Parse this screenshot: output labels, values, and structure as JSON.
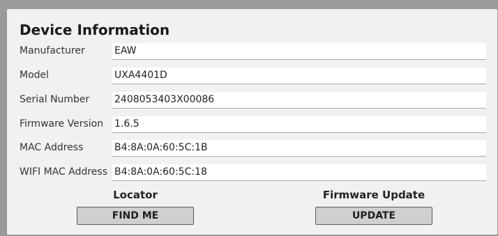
{
  "title": "Device Information",
  "rows": [
    {
      "label": "Manufacturer",
      "value": "EAW"
    },
    {
      "label": "Model",
      "value": "UXA4401D"
    },
    {
      "label": "Serial Number",
      "value": "2408053403X00086"
    },
    {
      "label": "Firmware Version",
      "value": "1.6.5"
    },
    {
      "label": "MAC Address",
      "value": "B4:8A:0A:60:5C:1B"
    },
    {
      "label": "WIFI MAC Address",
      "value": "B4:8A:0A:60:5C:18"
    }
  ],
  "locator": {
    "heading": "Locator",
    "button_label": "FIND ME"
  },
  "firmware_update": {
    "heading": "Firmware Update",
    "button_label": "UPDATE"
  }
}
